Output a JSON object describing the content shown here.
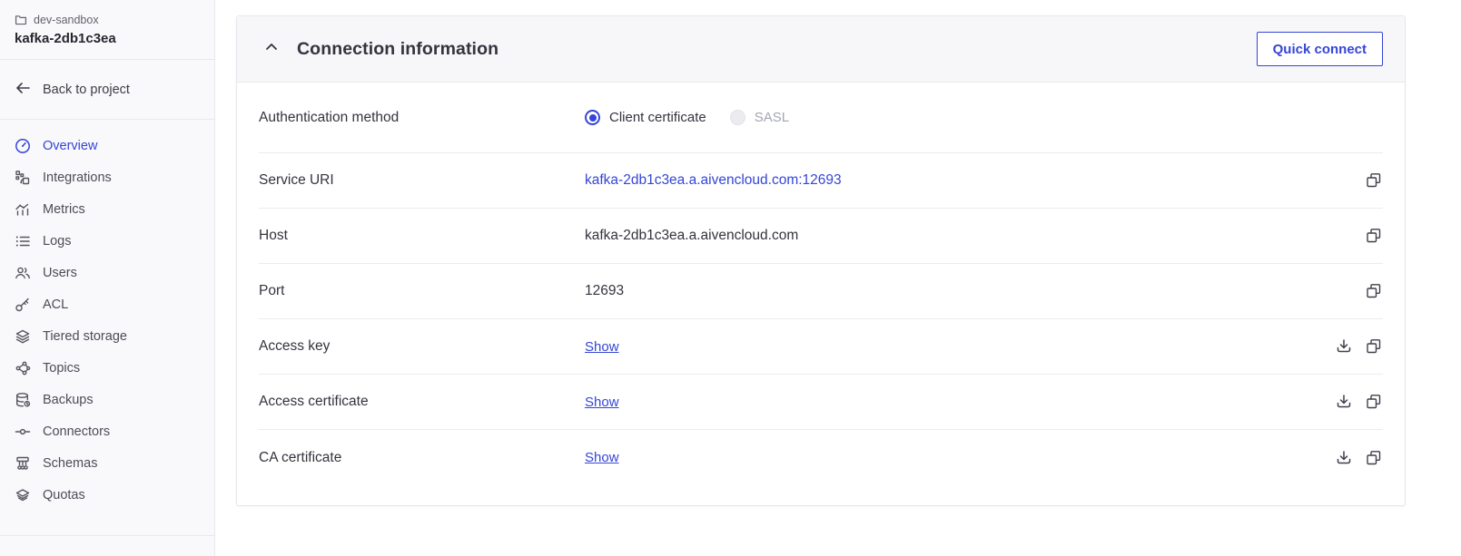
{
  "colors": {
    "accent": "#3545d6",
    "link": "#3545d6",
    "sidebar_bg": "#f9f9fb",
    "card_header_bg": "#f7f7fa",
    "divider": "#ececf1",
    "text_dark": "#33343e",
    "text_muted": "#62636d",
    "text_disabled": "#a4a6b3"
  },
  "sidebar": {
    "project": {
      "label": "dev-sandbox",
      "icon": "folder-icon"
    },
    "service_name": "kafka-2db1c3ea",
    "back": {
      "label": "Back to project",
      "icon": "arrow-left-icon"
    },
    "items": [
      {
        "label": "Overview",
        "icon": "gauge-icon",
        "active": true
      },
      {
        "label": "Integrations",
        "icon": "integrations-icon",
        "active": false
      },
      {
        "label": "Metrics",
        "icon": "metrics-icon",
        "active": false
      },
      {
        "label": "Logs",
        "icon": "logs-icon",
        "active": false
      },
      {
        "label": "Users",
        "icon": "users-icon",
        "active": false
      },
      {
        "label": "ACL",
        "icon": "key-icon",
        "active": false
      },
      {
        "label": "Tiered storage",
        "icon": "layers-icon",
        "active": false
      },
      {
        "label": "Topics",
        "icon": "topology-icon",
        "active": false
      },
      {
        "label": "Backups",
        "icon": "database-backup-icon",
        "active": false
      },
      {
        "label": "Connectors",
        "icon": "connector-icon",
        "active": false
      },
      {
        "label": "Schemas",
        "icon": "schema-icon",
        "active": false
      },
      {
        "label": "Quotas",
        "icon": "stack-icon",
        "active": false
      }
    ]
  },
  "panel": {
    "title": "Connection information",
    "collapse_icon": "chevron-up-icon",
    "quick_connect_label": "Quick connect",
    "auth": {
      "label": "Authentication method",
      "options": [
        {
          "label": "Client certificate",
          "selected": true,
          "disabled": false
        },
        {
          "label": "SASL",
          "selected": false,
          "disabled": true
        }
      ]
    },
    "rows": [
      {
        "label": "Service URI",
        "value": "kafka-2db1c3ea.a.aivencloud.com:12693",
        "value_type": "link",
        "actions": [
          "copy"
        ]
      },
      {
        "label": "Host",
        "value": "kafka-2db1c3ea.a.aivencloud.com",
        "value_type": "text",
        "actions": [
          "copy"
        ]
      },
      {
        "label": "Port",
        "value": "12693",
        "value_type": "text",
        "actions": [
          "copy"
        ]
      },
      {
        "label": "Access key",
        "value": "Show",
        "value_type": "show-link",
        "actions": [
          "download",
          "copy"
        ]
      },
      {
        "label": "Access certificate",
        "value": "Show",
        "value_type": "show-link",
        "actions": [
          "download",
          "copy"
        ]
      },
      {
        "label": "CA certificate",
        "value": "Show",
        "value_type": "show-link",
        "actions": [
          "download",
          "copy"
        ]
      }
    ]
  }
}
